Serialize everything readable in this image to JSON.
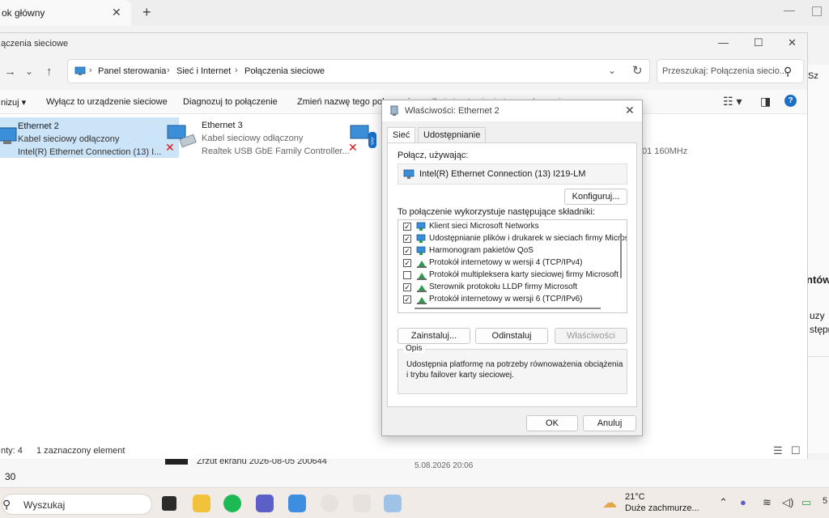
{
  "browser": {
    "tab_title": "ok główny",
    "tab_close": "✕",
    "new_tab": "+"
  },
  "background": {
    "right_sza": "Sz",
    "right_heading": "ntów",
    "right_line1": "uzy",
    "right_line2": "stępn",
    "bottom_count": "30",
    "screenshot_name": "Zrzut ekranu 2026-08-05 200644",
    "screenshot_date": "5.08.2026 20:06"
  },
  "explorer": {
    "title": "ączenia sieciowe",
    "breadcrumb": [
      "Panel sterowania",
      "Sieć i Internet",
      "Połączenia sieciowe"
    ],
    "search_placeholder": "Przeszukaj: Połączenia siecio...",
    "commands": [
      "nizuj",
      "Wyłącz to urządzenie sieciowe",
      "Diagnozuj to połączenie",
      "Zmień nazwę tego połączenia",
      "Zmień ustawienia tego połączenia"
    ],
    "items": [
      {
        "name": "Ethernet 2",
        "status": "Kabel sieciowy odłączony",
        "device": "Intel(R) Ethernet Connection (13) I..."
      },
      {
        "name": "Ethernet 3",
        "status": "Kabel sieciowy odłączony",
        "device": "Realtek USB GbE Family Controller..."
      },
      {
        "name": "",
        "status": "",
        "device": "01 160MHz"
      }
    ],
    "status": {
      "count": "nty: 4",
      "selected": "1 zaznaczony element"
    }
  },
  "dialog": {
    "title": "Właściwości: Ethernet 2",
    "tabs": [
      "Sieć",
      "Udostępnianie"
    ],
    "connect_using_label": "Połącz, używając:",
    "adapter": "Intel(R) Ethernet Connection (13) I219-LM",
    "configure_button": "Konfiguruj...",
    "components_label": "To połączenie wykorzystuje następujące składniki:",
    "components": [
      {
        "label": "Klient sieci Microsoft Networks",
        "checked": true,
        "icon": "network-client-icon"
      },
      {
        "label": "Udostępnianie plików i drukarek w sieciach firmy Micros",
        "checked": true,
        "icon": "network-client-icon"
      },
      {
        "label": "Harmonogram pakietów QoS",
        "checked": true,
        "icon": "network-client-icon"
      },
      {
        "label": "Protokół internetowy w wersji 4 (TCP/IPv4)",
        "checked": true,
        "icon": "protocol-icon"
      },
      {
        "label": "Protokół multipleksera karty sieciowej firmy Microsoft",
        "checked": false,
        "icon": "protocol-icon"
      },
      {
        "label": "Sterownik protokołu LLDP firmy Microsoft",
        "checked": true,
        "icon": "protocol-icon"
      },
      {
        "label": "Protokół internetowy w wersji 6 (TCP/IPv6)",
        "checked": true,
        "icon": "protocol-icon"
      }
    ],
    "install_button": "Zainstaluj...",
    "uninstall_button": "Odinstaluj",
    "properties_button": "Właściwości",
    "description_legend": "Opis",
    "description": "Udostępnia platformę na potrzeby równoważenia obciążenia i trybu failover karty sieciowej.",
    "ok_button": "OK",
    "cancel_button": "Anuluj"
  },
  "taskbar": {
    "search_placeholder": "Wyszukaj",
    "weather_temp": "21°C",
    "weather_cond": "Duże zachmurze...",
    "clock_partial": "5"
  },
  "colors": {
    "accent": "#1a6fc9",
    "selection": "#cce4f7",
    "taskbar": "#f0ebe6"
  }
}
